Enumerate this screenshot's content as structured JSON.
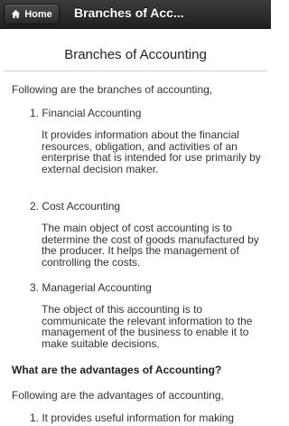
{
  "header": {
    "home_label": "Home",
    "title": "Branches of Acc..."
  },
  "page": {
    "title": "Branches of Accounting",
    "intro": "Following are the branches of accounting,",
    "items": [
      {
        "heading": "1. Financial Accounting",
        "description": "It provides information about the financial resources, obligation, and activities of an enterprise that is intended for use primarily by external decision maker."
      },
      {
        "heading": "2. Cost Accounting",
        "description": "The main object of cost accounting is to determine the cost of goods manufactured by the producer. It helps the management of controlling the costs."
      },
      {
        "heading": "3. Managerial Accounting",
        "description": "The object of this accounting is to communicate the relevant information to the management of the business to enable it to make suitable decisions."
      }
    ],
    "advantages_heading": "What are the advantages of Accounting?",
    "advantages_intro": "Following are the advantages of accounting,",
    "advantages_items": [
      "1. It provides useful information for making"
    ]
  },
  "colors": {
    "header_bg": "#2b2b2b",
    "text": "#333333"
  }
}
